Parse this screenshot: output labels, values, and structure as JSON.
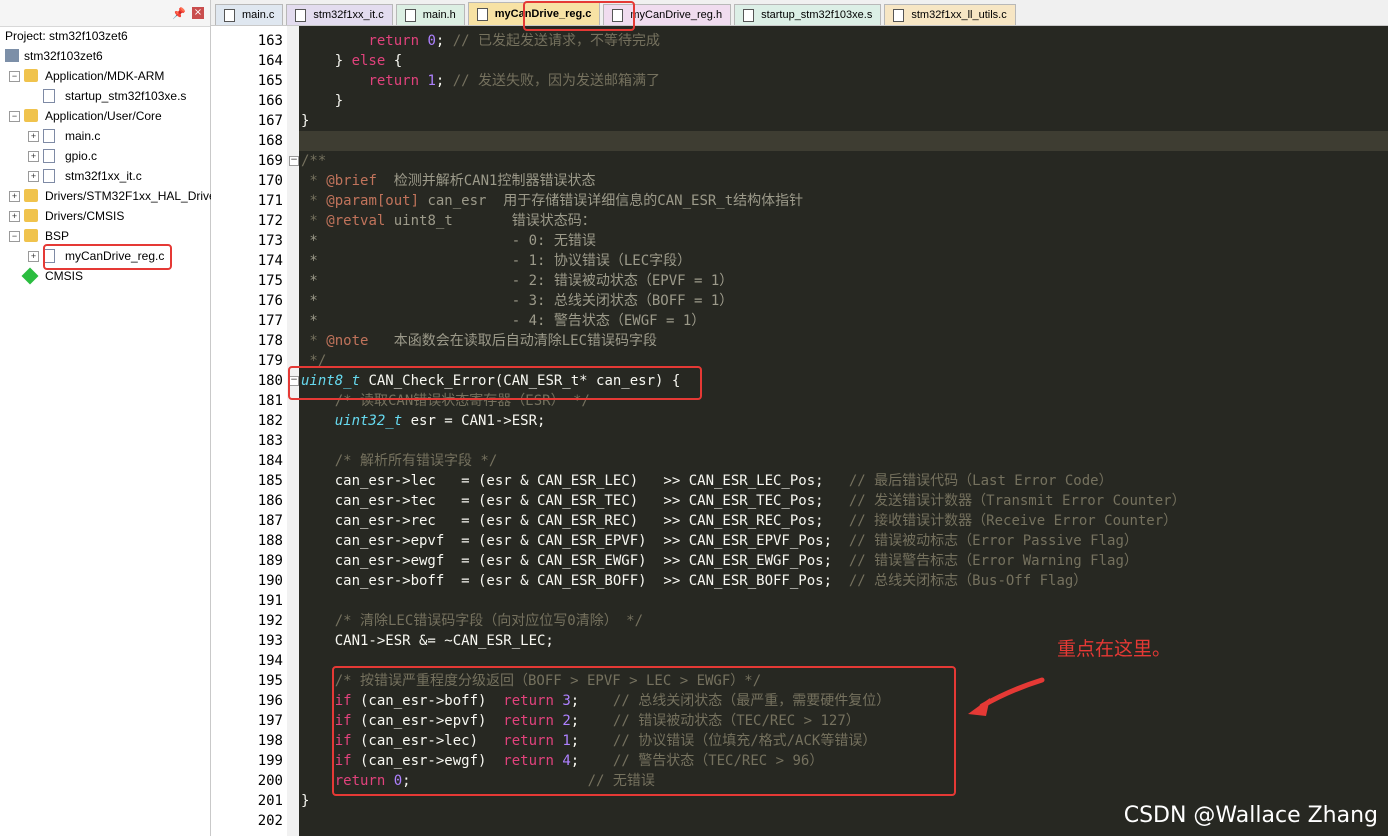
{
  "project_panel": {
    "project_title": "Project: stm32f103zet6",
    "root": "stm32f103zet6",
    "items": [
      {
        "label": "Application/MDK-ARM",
        "kind": "folder",
        "depth": 1,
        "expander": "−"
      },
      {
        "label": "startup_stm32f103xe.s",
        "kind": "file",
        "depth": 2,
        "expander": ""
      },
      {
        "label": "Application/User/Core",
        "kind": "folder",
        "depth": 1,
        "expander": "−"
      },
      {
        "label": "main.c",
        "kind": "file",
        "depth": 2,
        "expander": "+"
      },
      {
        "label": "gpio.c",
        "kind": "file",
        "depth": 2,
        "expander": "+"
      },
      {
        "label": "stm32f1xx_it.c",
        "kind": "file",
        "depth": 2,
        "expander": "+"
      },
      {
        "label": "Drivers/STM32F1xx_HAL_Driver",
        "kind": "folder",
        "depth": 1,
        "expander": "+"
      },
      {
        "label": "Drivers/CMSIS",
        "kind": "folder",
        "depth": 1,
        "expander": "+"
      },
      {
        "label": "BSP",
        "kind": "folder",
        "depth": 1,
        "expander": "−"
      },
      {
        "label": "myCanDrive_reg.c",
        "kind": "file",
        "depth": 2,
        "expander": "+"
      },
      {
        "label": "CMSIS",
        "kind": "cmsis",
        "depth": 1,
        "expander": ""
      }
    ],
    "pin_icon": "pin-icon",
    "close_icon": "close-icon"
  },
  "tabs": [
    {
      "label": "main.c",
      "active": false
    },
    {
      "label": "stm32f1xx_it.c",
      "active": false
    },
    {
      "label": "main.h",
      "active": false
    },
    {
      "label": "myCanDrive_reg.c",
      "active": true
    },
    {
      "label": "myCanDrive_reg.h",
      "active": false
    },
    {
      "label": "startup_stm32f103xe.s",
      "active": false
    },
    {
      "label": "stm32f1xx_ll_utils.c",
      "active": false
    }
  ],
  "code_lines": [
    {
      "n": "163",
      "t": [
        [
          "    ",
          "p"
        ],
        [
          "    return",
          "k"
        ],
        [
          " ",
          "p"
        ],
        [
          "0",
          "n"
        ],
        [
          "; ",
          "p"
        ],
        [
          "// 已发起发送请求，不等待完成",
          "c"
        ]
      ]
    },
    {
      "n": "164",
      "t": [
        [
          "    } ",
          "p"
        ],
        [
          "else",
          "k"
        ],
        [
          " {",
          "p"
        ]
      ]
    },
    {
      "n": "165",
      "t": [
        [
          "        ",
          "p"
        ],
        [
          "return",
          "k"
        ],
        [
          " ",
          "p"
        ],
        [
          "1",
          "n"
        ],
        [
          "; ",
          "p"
        ],
        [
          "// 发送失败，因为发送邮箱满了",
          "c"
        ]
      ]
    },
    {
      "n": "166",
      "t": [
        [
          "    }",
          "p"
        ]
      ]
    },
    {
      "n": "167",
      "t": [
        [
          "}",
          "p"
        ]
      ]
    },
    {
      "n": "168",
      "t": []
    },
    {
      "n": "169",
      "t": [
        [
          "/**",
          "c"
        ]
      ]
    },
    {
      "n": "170",
      "t": [
        [
          " * ",
          "c"
        ],
        [
          "@brief",
          "g"
        ],
        [
          "  检测并解析CAN1控制器错误状态",
          "d"
        ]
      ]
    },
    {
      "n": "171",
      "t": [
        [
          " * ",
          "c"
        ],
        [
          "@param[out]",
          "g"
        ],
        [
          " can_esr  用于存储错误详细信息的CAN_ESR_t结构体指针",
          "d"
        ]
      ]
    },
    {
      "n": "172",
      "t": [
        [
          " * ",
          "c"
        ],
        [
          "@retval",
          "g"
        ],
        [
          " uint8_t       错误状态码：",
          "d"
        ]
      ]
    },
    {
      "n": "173",
      "t": [
        [
          " *                       - 0: 无错误",
          "d"
        ]
      ]
    },
    {
      "n": "174",
      "t": [
        [
          " *                       - 1: 协议错误（LEC字段）",
          "d"
        ]
      ]
    },
    {
      "n": "175",
      "t": [
        [
          " *                       - 2: 错误被动状态（EPVF = 1）",
          "d"
        ]
      ]
    },
    {
      "n": "176",
      "t": [
        [
          " *                       - 3: 总线关闭状态（BOFF = 1）",
          "d"
        ]
      ]
    },
    {
      "n": "177",
      "t": [
        [
          " *                       - 4: 警告状态（EWGF = 1）",
          "d"
        ]
      ]
    },
    {
      "n": "178",
      "t": [
        [
          " * ",
          "c"
        ],
        [
          "@note",
          "g"
        ],
        [
          "   本函数会在读取后自动清除LEC错误码字段",
          "d"
        ]
      ]
    },
    {
      "n": "179",
      "t": [
        [
          " */",
          "c"
        ]
      ]
    },
    {
      "n": "180",
      "t": [
        [
          "uint8_t",
          "t"
        ],
        [
          " CAN_Check_Error(CAN_ESR_t* can_esr) {",
          "p"
        ]
      ]
    },
    {
      "n": "181",
      "t": [
        [
          "    ",
          "p"
        ],
        [
          "/* 读取CAN错误状态寄存器（ESR） */",
          "c"
        ]
      ]
    },
    {
      "n": "182",
      "t": [
        [
          "    ",
          "p"
        ],
        [
          "uint32_t",
          "t"
        ],
        [
          " esr = CAN1->ESR;",
          "p"
        ]
      ]
    },
    {
      "n": "183",
      "t": []
    },
    {
      "n": "184",
      "t": [
        [
          "    ",
          "p"
        ],
        [
          "/* 解析所有错误字段 */",
          "c"
        ]
      ]
    },
    {
      "n": "185",
      "t": [
        [
          "    can_esr->lec   = (esr & CAN_ESR_LEC)   >> CAN_ESR_LEC_Pos;   ",
          "p"
        ],
        [
          "// 最后错误代码（Last Error Code）",
          "c"
        ]
      ]
    },
    {
      "n": "186",
      "t": [
        [
          "    can_esr->tec   = (esr & CAN_ESR_TEC)   >> CAN_ESR_TEC_Pos;   ",
          "p"
        ],
        [
          "// 发送错误计数器（Transmit Error Counter）",
          "c"
        ]
      ]
    },
    {
      "n": "187",
      "t": [
        [
          "    can_esr->rec   = (esr & CAN_ESR_REC)   >> CAN_ESR_REC_Pos;   ",
          "p"
        ],
        [
          "// 接收错误计数器（Receive Error Counter）",
          "c"
        ]
      ]
    },
    {
      "n": "188",
      "t": [
        [
          "    can_esr->epvf  = (esr & CAN_ESR_EPVF)  >> CAN_ESR_EPVF_Pos;  ",
          "p"
        ],
        [
          "// 错误被动标志（Error Passive Flag）",
          "c"
        ]
      ]
    },
    {
      "n": "189",
      "t": [
        [
          "    can_esr->ewgf  = (esr & CAN_ESR_EWGF)  >> CAN_ESR_EWGF_Pos;  ",
          "p"
        ],
        [
          "// 错误警告标志（Error Warning Flag）",
          "c"
        ]
      ]
    },
    {
      "n": "190",
      "t": [
        [
          "    can_esr->boff  = (esr & CAN_ESR_BOFF)  >> CAN_ESR_BOFF_Pos;  ",
          "p"
        ],
        [
          "// 总线关闭标志（Bus-Off Flag）",
          "c"
        ]
      ]
    },
    {
      "n": "191",
      "t": []
    },
    {
      "n": "192",
      "t": [
        [
          "    ",
          "p"
        ],
        [
          "/* 清除LEC错误码字段（向对应位写0清除） */",
          "c"
        ]
      ]
    },
    {
      "n": "193",
      "t": [
        [
          "    CAN1->ESR &= ~CAN_ESR_LEC;",
          "p"
        ]
      ]
    },
    {
      "n": "194",
      "t": []
    },
    {
      "n": "195",
      "t": [
        [
          "    ",
          "p"
        ],
        [
          "/* 按错误严重程度分级返回（BOFF > EPVF > LEC > EWGF）*/",
          "c"
        ]
      ]
    },
    {
      "n": "196",
      "t": [
        [
          "    ",
          "p"
        ],
        [
          "if",
          "k"
        ],
        [
          " (can_esr->boff)  ",
          "p"
        ],
        [
          "return",
          "k"
        ],
        [
          " ",
          "p"
        ],
        [
          "3",
          "n"
        ],
        [
          ";    ",
          "p"
        ],
        [
          "// 总线关闭状态（最严重，需要硬件复位）",
          "c"
        ]
      ]
    },
    {
      "n": "197",
      "t": [
        [
          "    ",
          "p"
        ],
        [
          "if",
          "k"
        ],
        [
          " (can_esr->epvf)  ",
          "p"
        ],
        [
          "return",
          "k"
        ],
        [
          " ",
          "p"
        ],
        [
          "2",
          "n"
        ],
        [
          ";    ",
          "p"
        ],
        [
          "// 错误被动状态（TEC/REC > 127）",
          "c"
        ]
      ]
    },
    {
      "n": "198",
      "t": [
        [
          "    ",
          "p"
        ],
        [
          "if",
          "k"
        ],
        [
          " (can_esr->lec)   ",
          "p"
        ],
        [
          "return",
          "k"
        ],
        [
          " ",
          "p"
        ],
        [
          "1",
          "n"
        ],
        [
          ";    ",
          "p"
        ],
        [
          "// 协议错误（位填充/格式/ACK等错误）",
          "c"
        ]
      ]
    },
    {
      "n": "199",
      "t": [
        [
          "    ",
          "p"
        ],
        [
          "if",
          "k"
        ],
        [
          " (can_esr->ewgf)  ",
          "p"
        ],
        [
          "return",
          "k"
        ],
        [
          " ",
          "p"
        ],
        [
          "4",
          "n"
        ],
        [
          ";    ",
          "p"
        ],
        [
          "// 警告状态（TEC/REC > 96）",
          "c"
        ]
      ]
    },
    {
      "n": "200",
      "t": [
        [
          "    ",
          "p"
        ],
        [
          "return",
          "k"
        ],
        [
          " ",
          "p"
        ],
        [
          "0",
          "n"
        ],
        [
          ";                     ",
          "p"
        ],
        [
          "// 无错误",
          "c"
        ]
      ]
    },
    {
      "n": "201",
      "t": [
        [
          "}",
          "p"
        ]
      ]
    },
    {
      "n": "202",
      "t": []
    }
  ],
  "annotation": {
    "note": "重点在这里。",
    "color": "#e53935"
  },
  "watermark": "CSDN @Wallace Zhang",
  "colors": {
    "editor_bg": "#272822",
    "keyword": "#e1427c",
    "type": "#66d9ef",
    "number": "#ae81ff",
    "comment": "#75715e",
    "highlight": "#e53935"
  }
}
